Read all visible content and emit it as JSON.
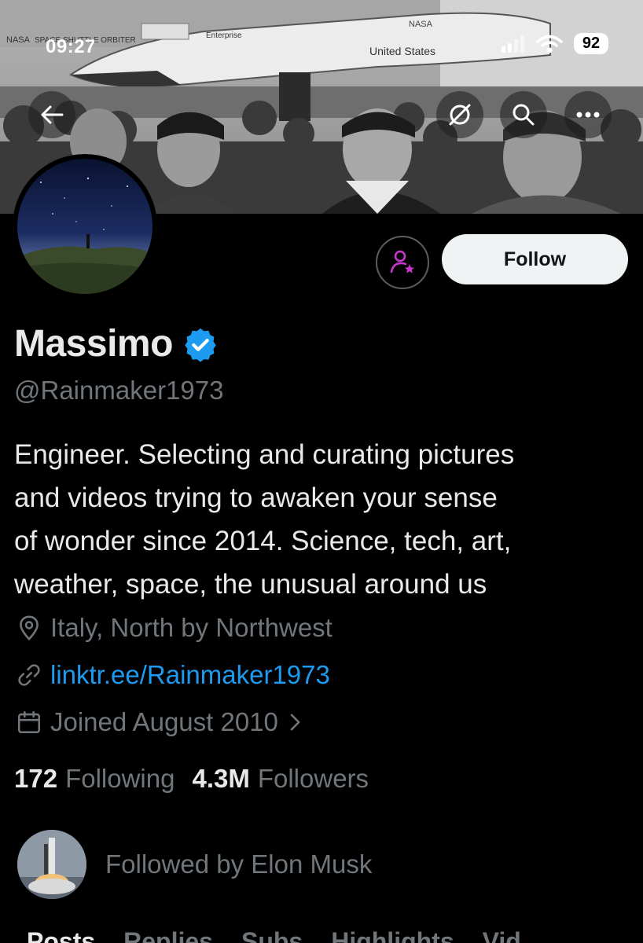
{
  "status_bar": {
    "time": "09:27",
    "battery": "92",
    "icons": [
      "signal-icon",
      "wifi-icon",
      "battery-icon"
    ]
  },
  "banner": {
    "description_icons": [
      "back-arrow-icon",
      "grok-icon",
      "search-icon",
      "more-icon"
    ],
    "texts": [
      "NASA",
      "SPACE SHUTTLE ORBITER",
      "Enterprise",
      "United States",
      "NASA"
    ]
  },
  "profile": {
    "display_name": "Massimo",
    "verified_icon": "verified-badge-icon",
    "handle": "@Rainmaker1973",
    "bio_lines": [
      "Engineer. Selecting and curating pictures",
      "and videos trying to awaken your sense",
      "of wonder since 2014. Science, tech, art,",
      "weather, space, the unusual around us"
    ],
    "location": "Italy, North by Northwest",
    "link": "linktr.ee/Rainmaker1973",
    "joined": "Joined August 2010",
    "following_count": "172",
    "following_label": "Following",
    "followers_count": "4.3M",
    "followers_label": "Followers",
    "followed_by": "Followed by Elon Musk"
  },
  "actions": {
    "follow_label": "Follow",
    "subscribe_icon": "subscribe-person-star-icon"
  },
  "tabs": [
    "Posts",
    "Replies",
    "Subs",
    "Highlights",
    "Vid"
  ],
  "colors": {
    "background": "#000000",
    "text_primary": "#e7e9ea",
    "text_secondary": "#71767b",
    "link": "#1d9bf0",
    "verified": "#1d9bf0",
    "subscribe_accent": "#c936cc"
  }
}
